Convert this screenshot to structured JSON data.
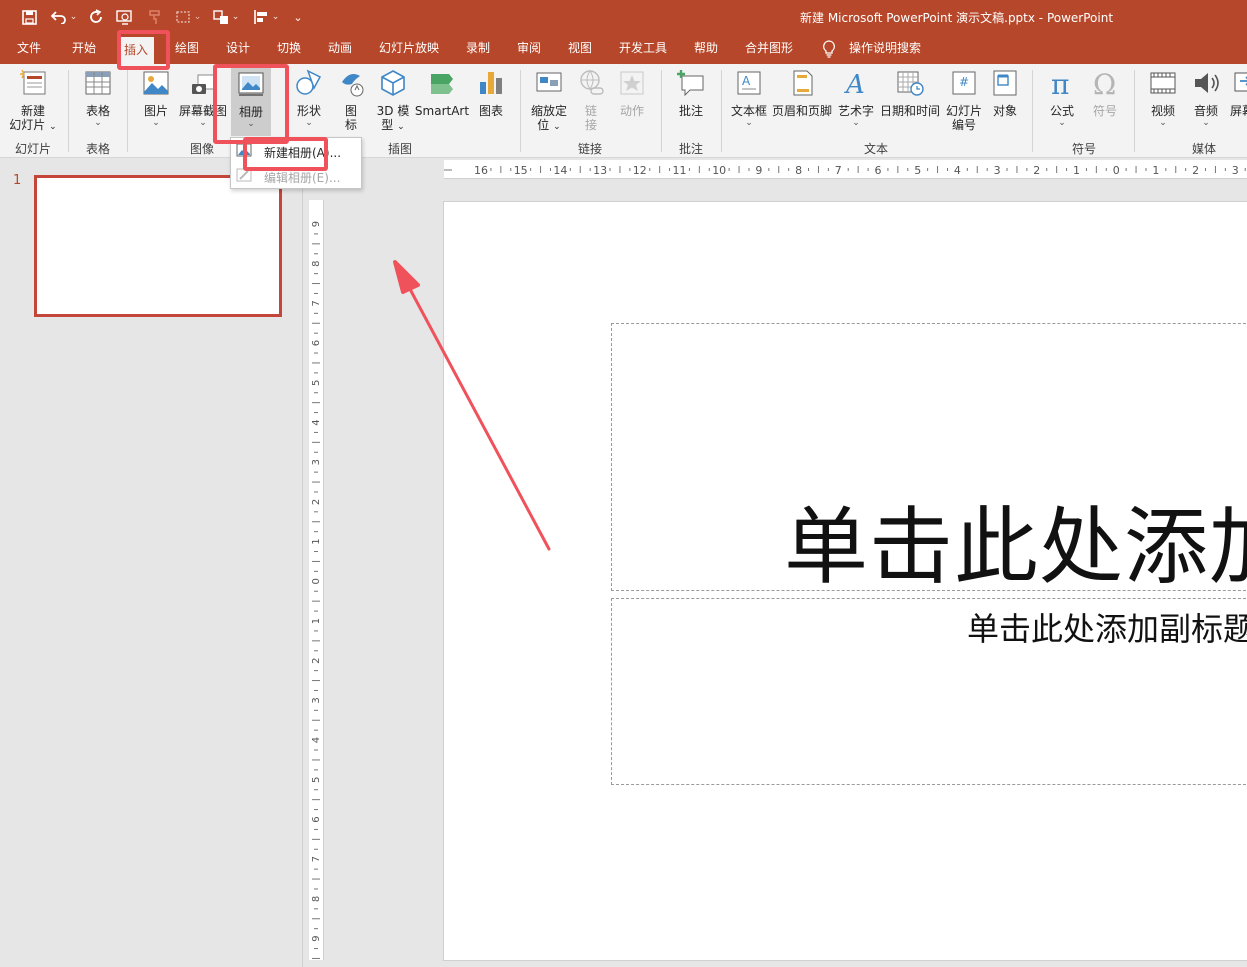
{
  "window": {
    "title": "新建 Microsoft PowerPoint 演示文稿.pptx  -  PowerPoint"
  },
  "quick_access": [
    {
      "icon": "save-icon"
    },
    {
      "icon": "undo-icon"
    },
    {
      "icon": "redo-icon"
    },
    {
      "icon": "present-from-start-icon"
    },
    {
      "icon": "format-painter-icon"
    },
    {
      "icon": "screenshot-icon"
    },
    {
      "icon": "arrange-icon"
    },
    {
      "icon": "align-icon"
    },
    {
      "icon": "customize-qat-icon"
    }
  ],
  "menu_tabs": [
    "文件",
    "开始",
    "插入",
    "绘图",
    "设计",
    "切换",
    "动画",
    "幻灯片放映",
    "录制",
    "审阅",
    "视图",
    "开发工具",
    "帮助",
    "合并图形",
    "操作说明搜索"
  ],
  "active_tab": "插入",
  "ribbon": {
    "new_slide": {
      "line1": "新建",
      "line2": "幻灯片"
    },
    "table": "表格",
    "picture": "图片",
    "screenshot": "屏幕截图",
    "photo_album": "相册",
    "shapes": "形状",
    "icons": {
      "line1": "图",
      "line2": "标"
    },
    "model_3d": {
      "line1": "3D 模",
      "line2": "型"
    },
    "smartart": "SmartArt",
    "chart": "图表",
    "zoom": {
      "line1": "缩放定",
      "line2": "位"
    },
    "link": {
      "line1": "链",
      "line2": "接"
    },
    "action": "动作",
    "comment": "批注",
    "textbox": "文本框",
    "header_footer": "页眉和页脚",
    "wordart": "艺术字",
    "datetime": "日期和时间",
    "slide_number": {
      "line1": "幻灯片",
      "line2": "编号"
    },
    "object": "对象",
    "equation": "公式",
    "symbol": "符号",
    "video": "视频",
    "audio": "音频",
    "screen_record": "屏幕录",
    "groups": {
      "slides": "幻灯片",
      "tables": "表格",
      "images": "图像",
      "illustrations": "插图",
      "links": "链接",
      "comments": "批注",
      "text": "文本",
      "symbols": "符号",
      "media": "媒体"
    }
  },
  "album_menu": {
    "new_album": "新建相册(A)...",
    "edit_album": "编辑相册(E)..."
  },
  "ruler": {
    "horizontal": [
      "16",
      "15",
      "14",
      "13",
      "12",
      "11",
      "10",
      "9",
      "8",
      "7",
      "6",
      "5",
      "4",
      "3",
      "2",
      "1",
      "0",
      "1",
      "2",
      "3"
    ],
    "vertical": [
      "9",
      "8",
      "7",
      "6",
      "5",
      "4",
      "3",
      "2",
      "1",
      "0",
      "1",
      "2",
      "3",
      "4",
      "5",
      "6",
      "7",
      "8",
      "9"
    ]
  },
  "thumbnails": [
    {
      "number": "1"
    }
  ],
  "slide": {
    "title_placeholder": "单击此处添加",
    "subtitle_placeholder": "单击此处添加副标题"
  },
  "colors": {
    "brand": "#b7472a",
    "callout": "#f0525c",
    "ribbon": "#f3f3f3"
  }
}
